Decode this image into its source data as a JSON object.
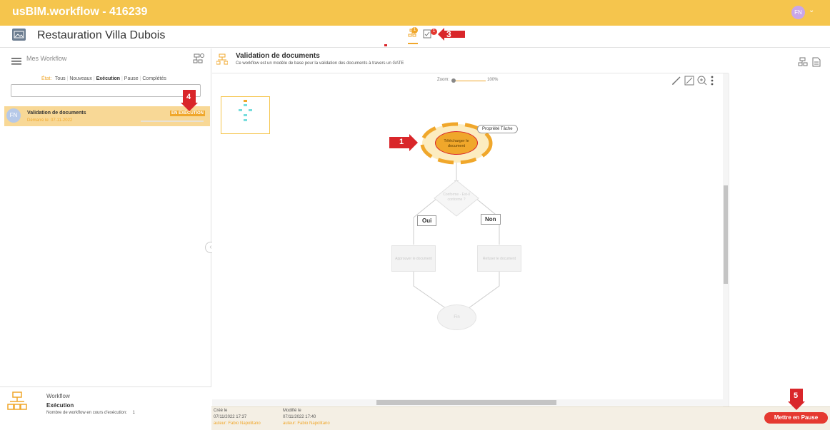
{
  "app": {
    "title": "usBIM.workflow - 416239",
    "user_initials": "FN"
  },
  "project": {
    "name": "Restauration Villa Dubois"
  },
  "tabs": [
    {
      "name": "workflow-tab",
      "badge": "1"
    },
    {
      "name": "tasks-tab",
      "badge": "1"
    }
  ],
  "sidebar": {
    "title": "Mes Workflow",
    "filter_label": "État:",
    "filters": [
      "Tous",
      "Nouveaux",
      "Exécution",
      "Pause",
      "Complétés"
    ],
    "search_placeholder": "",
    "items": [
      {
        "avatar": "FN",
        "name": "Validation de documents",
        "status": "EN EXÉCUTION",
        "started": "Démarré le: 07-11-2022"
      }
    ]
  },
  "workflow": {
    "title": "Validation de documents",
    "description": "Ce workflow est un modèle de base pour la validation des documents à travers un GATE",
    "zoom_label": "Zoom:",
    "zoom_value": "100%",
    "zoom_level": 1.0,
    "nodes": {
      "start": "Télécharger le document",
      "properties": "Propriété Tâche",
      "gate": "Conforme - Est-il conforme ?",
      "yes": "Oui",
      "no": "Non",
      "approve": "Approuver le document",
      "reject": "Refuser le document",
      "end": "Fin"
    }
  },
  "footer": {
    "section": "Workflow",
    "state": "Exécution",
    "count_label": "Nombre de workflow en cours d'exécution:",
    "count": "1",
    "created_label": "Créé le",
    "created_date": "07/11/2022 17:37",
    "created_author": "auteur: Fabio Napolitano",
    "modified_label": "Modifié le",
    "modified_date": "07/11/2022 17:40",
    "modified_author": "auteur: Fabio Napolitano",
    "pause_button": "Mettre en Pause"
  },
  "callouts": [
    "1",
    "3",
    "4",
    "5"
  ],
  "colors": {
    "brand": "#f5c54d",
    "accent": "#f0a72b",
    "danger": "#e53930",
    "arrow": "#d9262a"
  }
}
